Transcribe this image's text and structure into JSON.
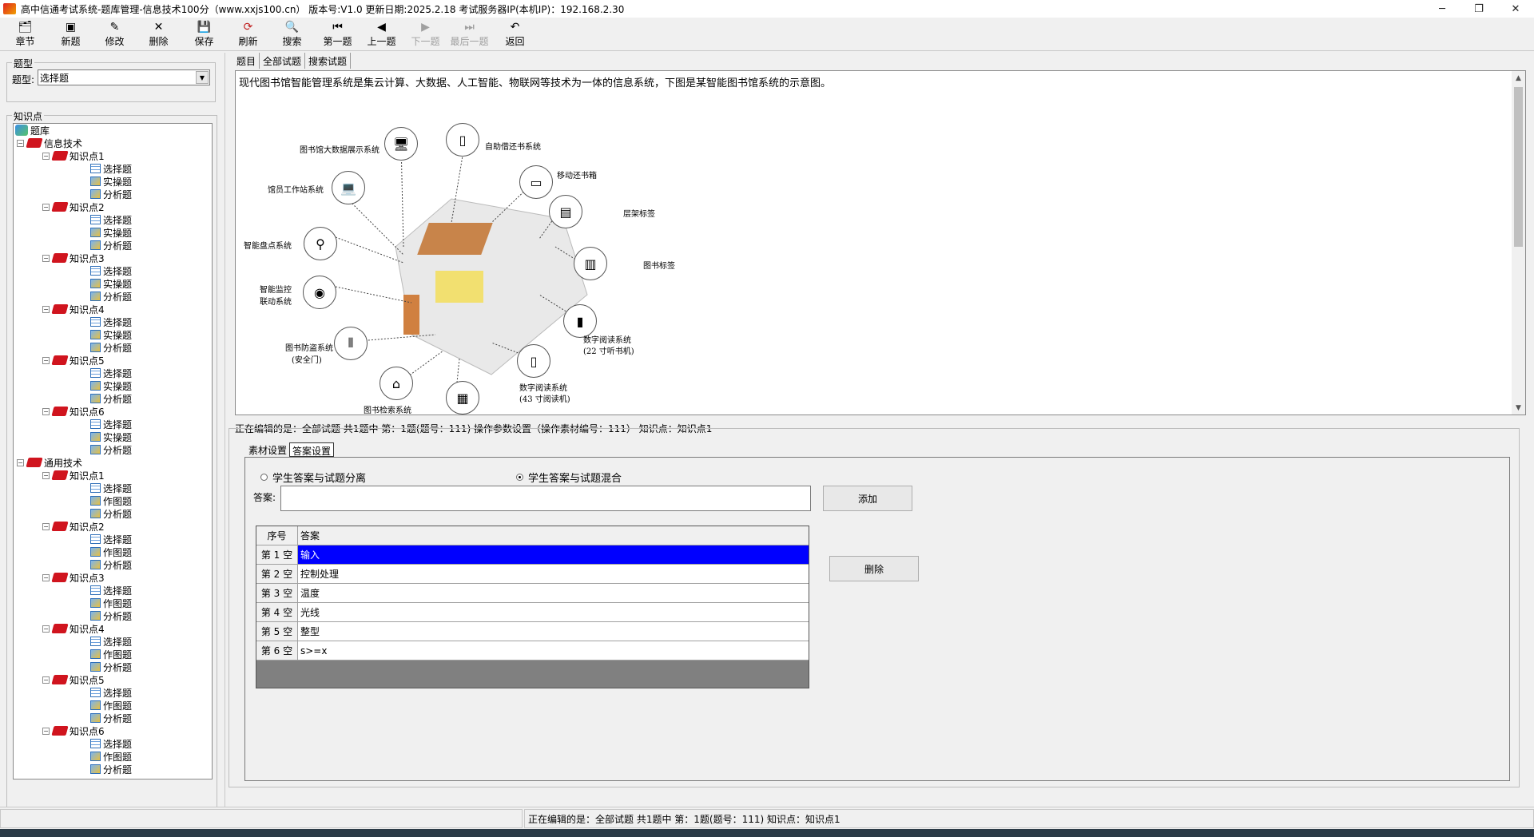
{
  "window": {
    "title": "高中信通考试系统-题库管理-信息技术100分（www.xxjs100.cn）  版本号:V1.0 更新日期:2025.2.18     考试服务器IP(本机IP)：192.168.2.30",
    "min_icon": "minimize-icon",
    "max_icon": "restore-icon",
    "close_icon": "close-icon"
  },
  "toolbar": {
    "chapter": "章节",
    "new": "新题",
    "edit": "修改",
    "delete": "删除",
    "save": "保存",
    "refresh": "刷新",
    "search": "搜索",
    "first": "第一题",
    "prev": "上一题",
    "next": "下一题",
    "last": "最后一题",
    "back": "返回"
  },
  "left": {
    "type_group": "题型",
    "type_label": "题型:",
    "type_value": "选择题",
    "knowledge_group": "知识点",
    "tree": {
      "root": "题库",
      "subjects": [
        {
          "name": "信息技术",
          "points": [
            {
              "name": "知识点1",
              "items": [
                "选择题",
                "实操题",
                "分析题"
              ]
            },
            {
              "name": "知识点2",
              "items": [
                "选择题",
                "实操题",
                "分析题"
              ]
            },
            {
              "name": "知识点3",
              "items": [
                "选择题",
                "实操题",
                "分析题"
              ]
            },
            {
              "name": "知识点4",
              "items": [
                "选择题",
                "实操题",
                "分析题"
              ]
            },
            {
              "name": "知识点5",
              "items": [
                "选择题",
                "实操题",
                "分析题"
              ]
            },
            {
              "name": "知识点6",
              "items": [
                "选择题",
                "实操题",
                "分析题"
              ]
            }
          ]
        },
        {
          "name": "通用技术",
          "points": [
            {
              "name": "知识点1",
              "items": [
                "选择题",
                "作图题",
                "分析题"
              ]
            },
            {
              "name": "知识点2",
              "items": [
                "选择题",
                "作图题",
                "分析题"
              ]
            },
            {
              "name": "知识点3",
              "items": [
                "选择题",
                "作图题",
                "分析题"
              ]
            },
            {
              "name": "知识点4",
              "items": [
                "选择题",
                "作图题",
                "分析题"
              ]
            },
            {
              "name": "知识点5",
              "items": [
                "选择题",
                "作图题",
                "分析题"
              ]
            },
            {
              "name": "知识点6",
              "items": [
                "选择题",
                "作图题",
                "分析题"
              ]
            }
          ]
        }
      ]
    }
  },
  "tabs": [
    "题目",
    "全部试题",
    "搜索试题"
  ],
  "question": {
    "text": "现代图书馆智能管理系统是集云计算、大数据、人工智能、物联网等技术为一体的信息系统，下图是某智能图书馆系统的示意图。",
    "diagram_labels": {
      "big_data": "图书馆大数据展示系统",
      "self_borrow": "自助借还书系统",
      "mobile_return": "移动还书箱",
      "staff": "馆员工作站系统",
      "shelf_tag": "层架标签",
      "inventory": "智能盘点系统",
      "book_tag": "图书标签",
      "monitor1": "智能监控",
      "monitor2": "联动系统",
      "digital22_1": "数字阅读系统",
      "digital22_2": "(22 寸听书机)",
      "anti_theft1": "图书防盗系统",
      "anti_theft2": "(安全门)",
      "digital43_1": "数字阅读系统",
      "digital43_2": "(43 寸阅读机)",
      "retrieval": "图书检索系统"
    }
  },
  "editing_status": "正在编辑的是：全部试题 共1题中   第：1题(题号：111) 操作参数设置（操作素材编号：111）  知识点：知识点1",
  "inner_tabs": [
    "素材设置",
    "答案设置"
  ],
  "answer_mode": {
    "separate": "学生答案与试题分离",
    "mixed": "学生答案与试题混合",
    "selected": "mixed"
  },
  "answer_label": "答案:",
  "answer_value": "",
  "add_button": "添加",
  "delete_button": "删除",
  "grid": {
    "headers": [
      "序号",
      "答案"
    ],
    "rows": [
      {
        "index": "第 1 空",
        "answer": "输入"
      },
      {
        "index": "第 2 空",
        "answer": "控制处理"
      },
      {
        "index": "第 3 空",
        "answer": "温度"
      },
      {
        "index": "第 4 空",
        "answer": "光线"
      },
      {
        "index": "第 5 空",
        "answer": "整型"
      },
      {
        "index": "第 6 空",
        "answer": "s>=x"
      }
    ],
    "selected_color": "#0000ff"
  },
  "statusbar": {
    "text": "正在编辑的是：全部试题 共1题中   第：1题(题号：111)  知识点：知识点1"
  }
}
